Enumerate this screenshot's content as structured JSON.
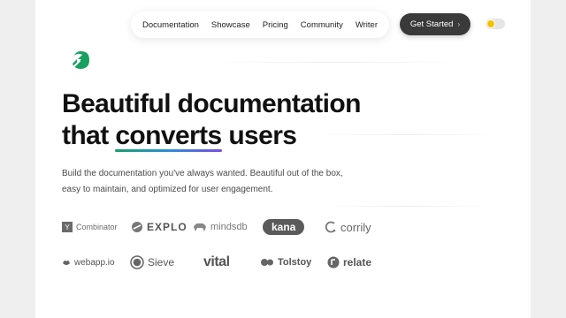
{
  "nav": {
    "links": [
      "Documentation",
      "Showcase",
      "Pricing",
      "Community",
      "Writer"
    ],
    "cta_label": "Get Started",
    "cta_arrow": "›"
  },
  "hero": {
    "title_line1": "Beautiful documentation",
    "title_line2_pre": "that ",
    "title_highlight": "converts",
    "title_line2_post": " users",
    "subtitle_line1": "Build the documentation you've always wanted. Beautiful out of the box,",
    "subtitle_line2": "easy to maintain, and optimized for user engagement."
  },
  "customer_logos": {
    "row1": {
      "ycombinator": {
        "mark": "Y",
        "name": "Combinator"
      },
      "explo": "EXPLO",
      "mindsdb": "mindsdb",
      "kana": "kana",
      "corrily": "corrily"
    },
    "row2": {
      "webapp": "webapp.io",
      "sieve": "Sieve",
      "vital": "vital",
      "tolstoy": "Tolstoy",
      "relate": "relate"
    }
  },
  "colors": {
    "cta_bg": "#3a3a3a",
    "logo_green": "#18a05e",
    "underline_gradient": [
      "#1a9e6a",
      "#2c8fd6",
      "#7a4de0"
    ],
    "toggle_sun": "#f2c200"
  },
  "icons": {
    "logo": "mintlify-leaf-logo",
    "toggle": "theme-toggle"
  }
}
